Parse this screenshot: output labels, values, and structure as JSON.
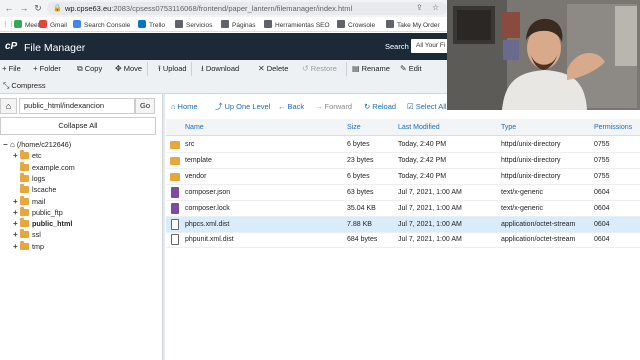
{
  "browser": {
    "url_host": "wp.cpse63.eu",
    "url_rest": ":2083/cpsess0753116068/frontend/paper_lantern/filemanager/index.html",
    "bookmarks": [
      {
        "label": "Meet",
        "color": "#34a853"
      },
      {
        "label": "Gmail",
        "color": "#ea4335"
      },
      {
        "label": "Search Console",
        "color": "#4285f4"
      },
      {
        "label": "Trello",
        "color": "#0079bf"
      },
      {
        "label": "Servicios",
        "color": "#5f6368"
      },
      {
        "label": "Páginas",
        "color": "#5f6368"
      },
      {
        "label": "Herramientas SEO",
        "color": "#5f6368"
      },
      {
        "label": "Crowsole",
        "color": "#5f6368"
      },
      {
        "label": "Take My Order",
        "color": "#5f6368"
      }
    ]
  },
  "header": {
    "logo": "cP",
    "title": "File Manager",
    "search_label": "Search",
    "search_scope": "All Your Fi"
  },
  "toolbar": {
    "row1": [
      {
        "icon": "+",
        "label": "File",
        "name": "new-file-button",
        "disabled": false
      },
      {
        "icon": "+",
        "label": "Folder",
        "name": "new-folder-button",
        "disabled": false
      },
      {
        "icon": "⧉",
        "label": "Copy",
        "name": "copy-button",
        "disabled": false
      },
      {
        "icon": "✥",
        "label": "Move",
        "name": "move-button",
        "disabled": false
      },
      {
        "icon": "⭱",
        "label": "Upload",
        "name": "upload-button",
        "disabled": false
      },
      {
        "icon": "⭳",
        "label": "Download",
        "name": "download-button",
        "disabled": false
      },
      {
        "icon": "✕",
        "label": "Delete",
        "name": "delete-button",
        "disabled": false
      },
      {
        "icon": "↺",
        "label": "Restore",
        "name": "restore-button",
        "disabled": true
      },
      {
        "icon": "▤",
        "label": "Rename",
        "name": "rename-button",
        "disabled": false
      },
      {
        "icon": "✎",
        "label": "Edit",
        "name": "edit-button",
        "disabled": false
      }
    ],
    "compress": {
      "icon": "⤡",
      "label": "Compress"
    }
  },
  "sidebar": {
    "path_value": "public_html/indexancion",
    "go_label": "Go",
    "collapse_label": "Collapse All",
    "tree": [
      {
        "label": "(/home/c212646)",
        "toggle": "−",
        "home": true,
        "bold": false,
        "depth": 0
      },
      {
        "label": "etc",
        "toggle": "+",
        "home": false,
        "bold": false,
        "depth": 1
      },
      {
        "label": "example.com",
        "toggle": "",
        "home": false,
        "bold": false,
        "depth": 1
      },
      {
        "label": "logs",
        "toggle": "",
        "home": false,
        "bold": false,
        "depth": 1
      },
      {
        "label": "lscache",
        "toggle": "",
        "home": false,
        "bold": false,
        "depth": 1
      },
      {
        "label": "mail",
        "toggle": "+",
        "home": false,
        "bold": false,
        "depth": 1
      },
      {
        "label": "public_ftp",
        "toggle": "+",
        "home": false,
        "bold": false,
        "depth": 1
      },
      {
        "label": "public_html",
        "toggle": "+",
        "home": false,
        "bold": true,
        "depth": 1
      },
      {
        "label": "ssl",
        "toggle": "+",
        "home": false,
        "bold": false,
        "depth": 1
      },
      {
        "label": "tmp",
        "toggle": "+",
        "home": false,
        "bold": false,
        "depth": 1
      }
    ]
  },
  "nav": {
    "home": "Home",
    "up": "Up One Level",
    "back": "Back",
    "forward": "Forward",
    "reload": "Reload",
    "select_all": "Select All"
  },
  "table": {
    "columns": [
      "Name",
      "Size",
      "Last Modified",
      "Type",
      "Permissions"
    ],
    "rows": [
      {
        "name": "src",
        "size": "6 bytes",
        "modified": "Today, 2:40 PM",
        "type": "httpd/unix-directory",
        "perms": "0755",
        "kind": "folder",
        "selected": false
      },
      {
        "name": "template",
        "size": "23 bytes",
        "modified": "Today, 2:42 PM",
        "type": "httpd/unix-directory",
        "perms": "0755",
        "kind": "folder",
        "selected": false
      },
      {
        "name": "vendor",
        "size": "6 bytes",
        "modified": "Today, 2:40 PM",
        "type": "httpd/unix-directory",
        "perms": "0755",
        "kind": "folder",
        "selected": false
      },
      {
        "name": "composer.json",
        "size": "63 bytes",
        "modified": "Jul 7, 2021, 1:00 AM",
        "type": "text/x-generic",
        "perms": "0604",
        "kind": "file",
        "selected": false
      },
      {
        "name": "composer.lock",
        "size": "35.04 KB",
        "modified": "Jul 7, 2021, 1:00 AM",
        "type": "text/x-generic",
        "perms": "0604",
        "kind": "file",
        "selected": false
      },
      {
        "name": "phpcs.xml.dist",
        "size": "7.88 KB",
        "modified": "Jul 7, 2021, 1:00 AM",
        "type": "application/octet-stream",
        "perms": "0604",
        "kind": "plain",
        "selected": true
      },
      {
        "name": "phpunit.xml.dist",
        "size": "684 bytes",
        "modified": "Jul 7, 2021, 1:00 AM",
        "type": "application/octet-stream",
        "perms": "0604",
        "kind": "plain",
        "selected": false
      }
    ]
  }
}
